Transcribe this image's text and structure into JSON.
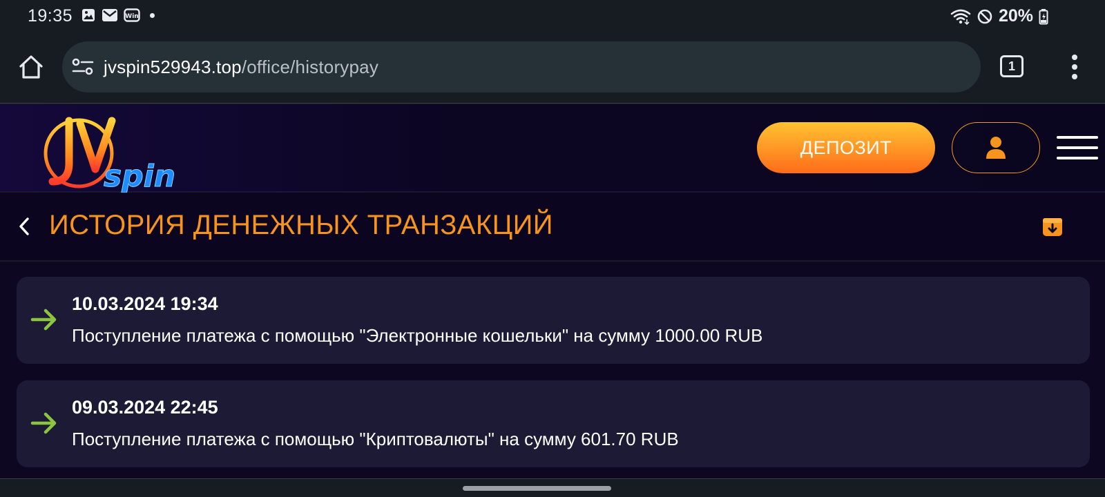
{
  "status_bar": {
    "time": "19:35",
    "battery": "20%"
  },
  "browser": {
    "url_domain": "jvspin529943.top",
    "url_path": "/office/historypay",
    "tab_count": "1"
  },
  "site": {
    "logo_text": "JVspin",
    "deposit_label": "ДЕПОЗИТ"
  },
  "page": {
    "title": "ИСТОРИЯ ДЕНЕЖНЫХ ТРАНЗАКЦИЙ"
  },
  "transactions": [
    {
      "datetime": "10.03.2024 19:34",
      "description": "Поступление платежа с помощью \"Электронные кошельки\" на сумму 1000.00 RUB"
    },
    {
      "datetime": "09.03.2024 22:45",
      "description": "Поступление платежа с помощью \"Криптовалюты\" на сумму 601.70 RUB"
    }
  ],
  "colors": {
    "accent_orange": "#f7941d",
    "arrow_green": "#8cc63f",
    "card_bg": "#1d1a36",
    "page_bg": "#0d0721"
  }
}
